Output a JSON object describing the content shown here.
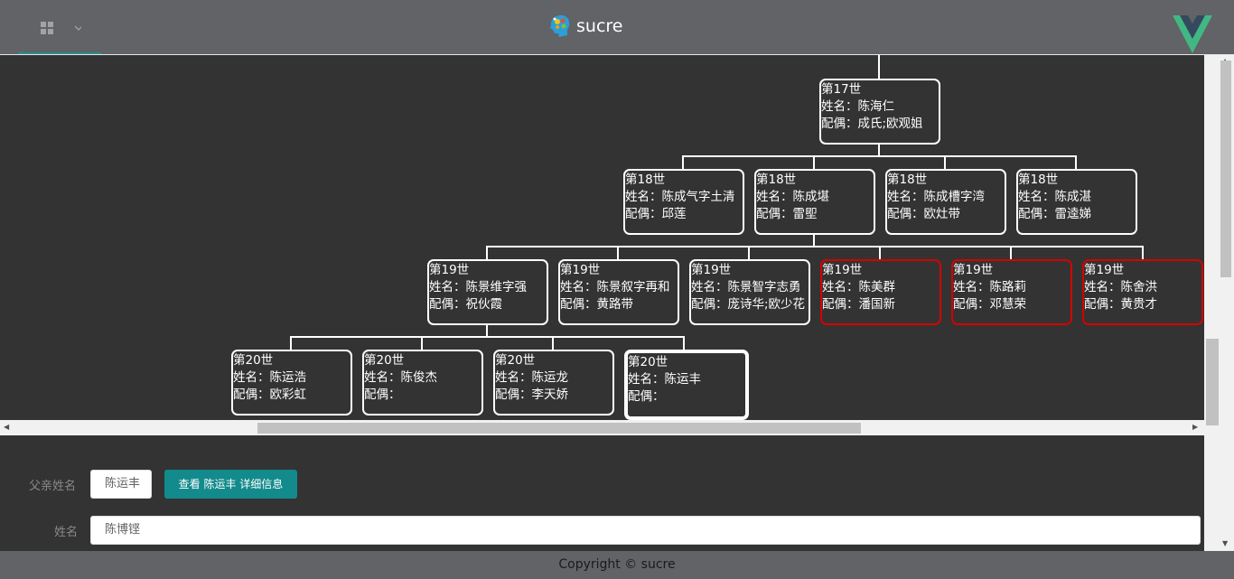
{
  "header": {
    "brand_name": "sucre",
    "menu_icon": "grid-icon",
    "dropdown_icon": "chevron-down-icon",
    "accent": "#2a8d8f"
  },
  "tree": {
    "gen17": [
      {
        "gen": "第17世",
        "name": "姓名：陈海仁",
        "spouse": "配偶：成氏;欧观姐",
        "highlight": false
      }
    ],
    "gen18": [
      {
        "gen": "第18世",
        "name": "姓名：陈成气字土清",
        "spouse": "配偶：邱莲"
      },
      {
        "gen": "第18世",
        "name": "姓名：陈成堪",
        "spouse": "配偶：雷堲"
      },
      {
        "gen": "第18世",
        "name": "姓名：陈成槽字湾",
        "spouse": "配偶：欧灶带"
      },
      {
        "gen": "第18世",
        "name": "姓名：陈成湛",
        "spouse": "配偶：雷逵娣"
      }
    ],
    "gen19": [
      {
        "gen": "第19世",
        "name": "姓名：陈景维字强",
        "spouse": "配偶：祝伙霞",
        "red": false
      },
      {
        "gen": "第19世",
        "name": "姓名：陈景叙字再和",
        "spouse": "配偶：黄路带",
        "red": false
      },
      {
        "gen": "第19世",
        "name": "姓名：陈景智字志勇",
        "spouse": "配偶：庞诗华;欧少花",
        "red": false
      },
      {
        "gen": "第19世",
        "name": "姓名：陈美群",
        "spouse": "配偶：潘国新",
        "red": true
      },
      {
        "gen": "第19世",
        "name": "姓名：陈路莉",
        "spouse": "配偶：邓慧荣",
        "red": true
      },
      {
        "gen": "第19世",
        "name": "姓名：陈舍洪",
        "spouse": "配偶：黄贵才",
        "red": true
      }
    ],
    "gen20": [
      {
        "gen": "第20世",
        "name": "姓名：陈运浩",
        "spouse": "配偶：欧彩虹"
      },
      {
        "gen": "第20世",
        "name": "姓名：陈俊杰",
        "spouse": "配偶："
      },
      {
        "gen": "第20世",
        "name": "姓名：陈运龙",
        "spouse": "配偶：李天娇"
      },
      {
        "gen": "第20世",
        "name": "姓名：陈运丰",
        "spouse": "配偶：",
        "selected": true
      }
    ]
  },
  "form": {
    "father_label": "父亲姓名",
    "father_value": "陈运丰",
    "detail_button": "查看 陈运丰 详细信息",
    "name_label": "姓名",
    "name_value": "陈博铿"
  },
  "footer": {
    "copyright": "Copyright © sucre"
  },
  "colors": {
    "background": "#333333",
    "header": "#616366",
    "node_border": "#ffffff",
    "node_border_female": "#d60000",
    "button": "#138a8c"
  }
}
